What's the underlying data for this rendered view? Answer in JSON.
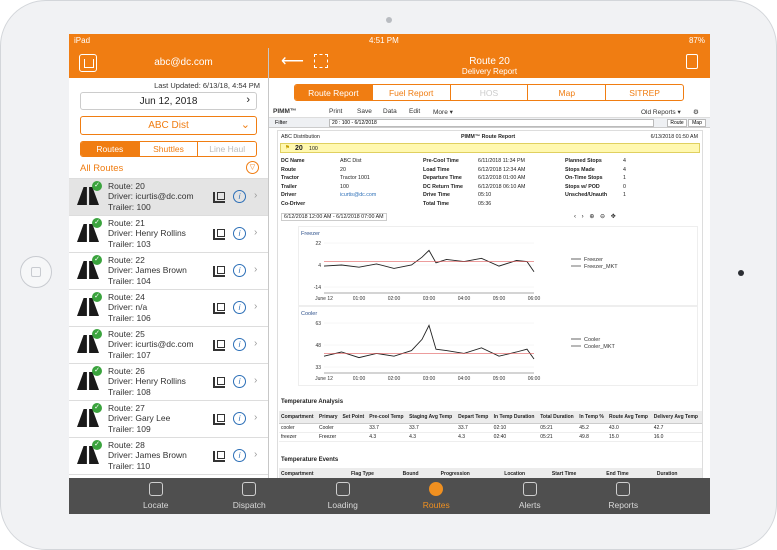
{
  "status": {
    "device": "iPad",
    "time": "4:51 PM",
    "battery": "87%"
  },
  "left": {
    "email": "abc@dc.com",
    "last_updated": "Last Updated: 6/13/18, 4:54 PM",
    "date": "Jun 12, 2018",
    "dist": "ABC Dist",
    "segments": [
      "Routes",
      "Shuttles",
      "Line Haul"
    ],
    "all_routes": "All Routes",
    "routes": [
      {
        "name": "Route: 20",
        "driver": "Driver: icurtis@dc.com",
        "trailer": "Trailer: 100"
      },
      {
        "name": "Route: 21",
        "driver": "Driver: Henry Rollins",
        "trailer": "Trailer: 103"
      },
      {
        "name": "Route: 22",
        "driver": "Driver: James Brown",
        "trailer": "Trailer: 104"
      },
      {
        "name": "Route: 24",
        "driver": "Driver: n/a",
        "trailer": "Trailer: 106"
      },
      {
        "name": "Route: 25",
        "driver": "Driver: icurtis@dc.com",
        "trailer": "Trailer: 107"
      },
      {
        "name": "Route: 26",
        "driver": "Driver: Henry Rollins",
        "trailer": "Trailer: 108"
      },
      {
        "name": "Route: 27",
        "driver": "Driver: Gary Lee",
        "trailer": "Trailer: 109"
      },
      {
        "name": "Route: 28",
        "driver": "Driver: James Brown",
        "trailer": "Trailer: 110"
      }
    ]
  },
  "right": {
    "title": "Route 20",
    "subtitle": "Delivery Report",
    "tabs": [
      "Route Report",
      "Fuel Report",
      "HOS",
      "Map",
      "SITREP"
    ],
    "toolbar": {
      "logo": "PIMM™",
      "print": "Print",
      "save": "Save",
      "data": "Data",
      "edit": "Edit",
      "more": "More ▾",
      "old": "Old Reports ▾"
    },
    "filter": {
      "label": "Filter",
      "value": "20 : 100 - 6/12/2018",
      "route": "Route",
      "map": "Map"
    },
    "report": {
      "dist": "ABC Distribution",
      "heading": "PIMM™ Route Report",
      "stamp": "6/13/2018 01:50 AM",
      "flag": "20",
      "flag_sub": "100",
      "col1": [
        [
          "DC Name",
          "ABC Dist"
        ],
        [
          "Route",
          "20"
        ],
        [
          "Tractor",
          "Tractor 1001"
        ],
        [
          "Trailer",
          "100"
        ],
        [
          "Driver",
          "icurtis@dc.com"
        ],
        [
          "Co-Driver",
          ""
        ]
      ],
      "col2": [
        [
          "Pre-Cool Time",
          "6/11/2018 11:34 PM"
        ],
        [
          "Load Time",
          "6/12/2018 12:34 AM"
        ],
        [
          "Departure Time",
          "6/12/2018 01:00 AM"
        ],
        [
          "DC Return Time",
          "6/12/2018 06:10 AM"
        ],
        [
          "Drive Time",
          "05:10"
        ],
        [
          "Total Time",
          "05:36"
        ]
      ],
      "col3": [
        [
          "Planned Stops",
          "4"
        ],
        [
          "Stops Made",
          "4"
        ],
        [
          "On-Time Stops",
          "1"
        ],
        [
          "Stops w/ POD",
          "0"
        ],
        [
          "Unsched/Unauth",
          "1"
        ]
      ],
      "range": "6/12/2018 12:00 AM - 6/12/2018 07:00 AM"
    },
    "temp_analysis": {
      "title": "Temperature Analysis",
      "headers": [
        "Compartment",
        "Primary",
        "Set Point",
        "Pre-cool Temp",
        "Staging Avg Temp",
        "Depart Temp",
        "In Temp Duration",
        "Total Duration",
        "In Temp %",
        "Route Avg Temp",
        "Delivery Avg Temp"
      ],
      "rows": [
        [
          "cooler",
          "Cooler",
          "",
          "33.7",
          "33.7",
          "33.7",
          "02:10",
          "05:21",
          "45.2",
          "43.0",
          "42.7"
        ],
        [
          "freezer",
          "Freezer",
          "",
          "4.3",
          "4.3",
          "4.3",
          "02:40",
          "05:21",
          "49.8",
          "15.0",
          "16.0"
        ]
      ]
    },
    "temp_events": {
      "title": "Temperature Events",
      "headers": [
        "Compartment",
        "Flag Type",
        "Bound",
        "Progression",
        "Location",
        "Start Time",
        "End Time",
        "Duration"
      ]
    }
  },
  "chart_data": [
    {
      "type": "line",
      "title": "Freezer",
      "ylim": [
        -20,
        30
      ],
      "yticks": [
        "22",
        "4",
        "-14"
      ],
      "categories": [
        "June 12",
        "01:00",
        "02:00",
        "03:00",
        "04:00",
        "05:00",
        "06:00"
      ],
      "x": [
        0,
        0.5,
        1,
        1.5,
        2,
        2.5,
        2.8,
        3,
        3.2,
        3.5,
        4,
        4.5,
        5,
        5.5,
        5.8,
        6
      ],
      "series": [
        {
          "name": "Freezer",
          "values": [
            4,
            5,
            3,
            6,
            2,
            5,
            12,
            18,
            7,
            10,
            8,
            11,
            4,
            9,
            8,
            -1
          ]
        },
        {
          "name": "Freezer_MKT",
          "values": [
            8,
            8,
            8,
            8,
            8,
            8,
            8,
            8,
            8,
            8,
            8,
            8,
            8,
            8,
            8,
            8
          ]
        }
      ]
    },
    {
      "type": "line",
      "title": "Cooler",
      "ylim": [
        28,
        68
      ],
      "yticks": [
        "63",
        "48",
        "33"
      ],
      "categories": [
        "June 12",
        "01:00",
        "02:00",
        "03:00",
        "04:00",
        "05:00",
        "06:00"
      ],
      "x": [
        0,
        0.5,
        1,
        1.5,
        2,
        2.5,
        2.8,
        3,
        3.2,
        3.5,
        4,
        4.5,
        5,
        5.5,
        5.8,
        6
      ],
      "series": [
        {
          "name": "Cooler",
          "values": [
            40,
            43,
            39,
            42,
            40,
            44,
            52,
            62,
            45,
            44,
            42,
            46,
            40,
            43,
            45,
            38
          ]
        },
        {
          "name": "Cooler_MKT",
          "values": [
            42,
            42,
            42,
            42,
            42,
            42,
            42,
            42,
            42,
            42,
            42,
            42,
            42,
            42,
            42,
            42
          ]
        }
      ]
    }
  ],
  "bottom": [
    "Locate",
    "Dispatch",
    "Loading",
    "Routes",
    "Alerts",
    "Reports"
  ]
}
